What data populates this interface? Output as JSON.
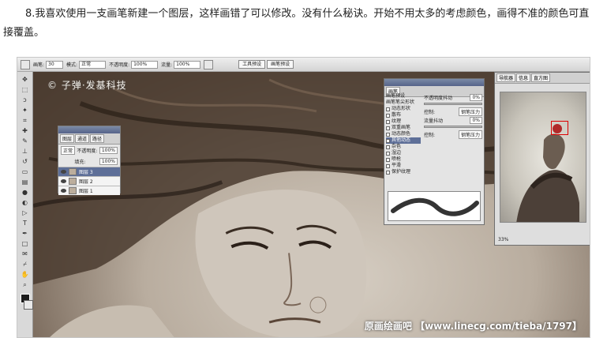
{
  "caption": "8.我喜欢使用一支画笔新建一个图层，这样画错了可以修改。没有什么秘诀。开始不用太多的考虑颜色，画得不准的颜色可直接覆盖。",
  "options_bar": {
    "brush_label": "画笔:",
    "brush_size": "30",
    "mode_label": "模式:",
    "mode_value": "正常",
    "opacity_label": "不透明度:",
    "opacity_value": "100%",
    "flow_label": "流量:",
    "flow_value": "100%",
    "tabs": [
      "工具预设",
      "画笔预设"
    ]
  },
  "watermarks": {
    "top": "© 子弹·发基科技",
    "bottom": "原画绘画吧 【www.linecg.com/tieba/1797】"
  },
  "layers_panel": {
    "tabs": [
      "图层",
      "通道",
      "路径"
    ],
    "mode": "正常",
    "opacity_label": "不透明度:",
    "opacity": "100%",
    "fill_label": "填充:",
    "fill": "100%",
    "layers": [
      "图层 3",
      "图层 2",
      "图层 1"
    ]
  },
  "brushes_panel": {
    "tab": "画笔",
    "items": [
      "画笔预设",
      "画笔笔尖形状",
      "动态形状",
      "散布",
      "纹理",
      "双重画笔",
      "动态颜色",
      "其他动态",
      "杂色",
      "湿边",
      "喷枪",
      "平滑",
      "保护纹理"
    ],
    "selected": "其他动态",
    "opacity_jitter_label": "不透明度抖动",
    "opacity_jitter_value": "0%",
    "control_label": "控制:",
    "control_value": "钢笔压力",
    "flow_jitter_label": "流量抖动",
    "flow_jitter_value": "0%"
  },
  "navigator": {
    "tabs": [
      "导航器",
      "信息",
      "直方图"
    ],
    "zoom": "33%"
  }
}
